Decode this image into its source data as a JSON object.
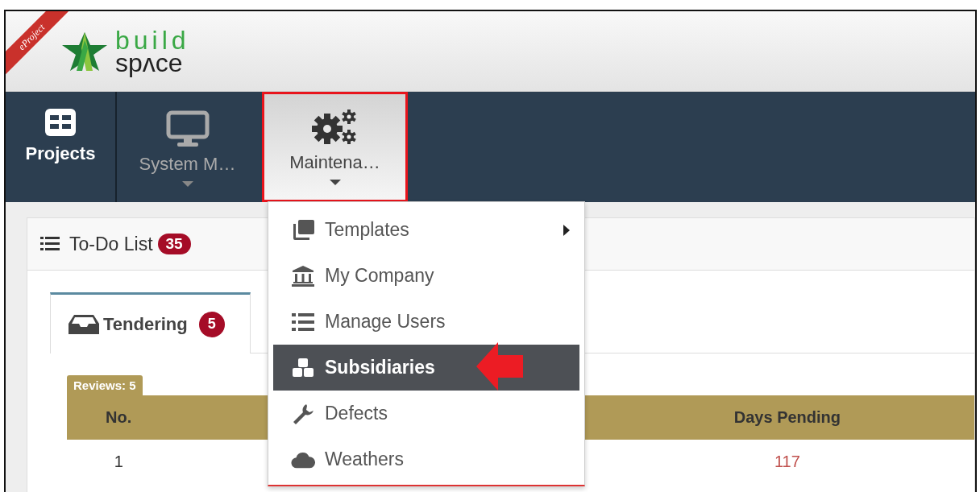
{
  "header": {
    "ribbon": "eProject",
    "logo_top": "build",
    "logo_bottom": "spʌce"
  },
  "nav": [
    {
      "label": "Projects",
      "selected": false,
      "disabled": false,
      "dropdown": false
    },
    {
      "label": "System M…",
      "selected": false,
      "disabled": true,
      "dropdown": true
    },
    {
      "label": "Maintena…",
      "selected": true,
      "disabled": false,
      "dropdown": true
    }
  ],
  "menu": [
    {
      "label": "Templates",
      "selected": false,
      "submenu": true
    },
    {
      "label": "My Company",
      "selected": false,
      "submenu": false
    },
    {
      "label": "Manage Users",
      "selected": false,
      "submenu": false
    },
    {
      "label": "Subsidiaries",
      "selected": true,
      "submenu": false
    },
    {
      "label": "Defects",
      "selected": false,
      "submenu": false
    },
    {
      "label": "Weathers",
      "selected": false,
      "submenu": false
    }
  ],
  "panel": {
    "title": "To-Do List",
    "count": "35"
  },
  "tabs": [
    {
      "label": "Tendering",
      "count": "5",
      "selected": true
    }
  ],
  "reviews": "Reviews: 5",
  "table": {
    "columns": [
      "No.",
      "Days Pending"
    ],
    "rows": [
      [
        "1",
        "117"
      ]
    ]
  }
}
